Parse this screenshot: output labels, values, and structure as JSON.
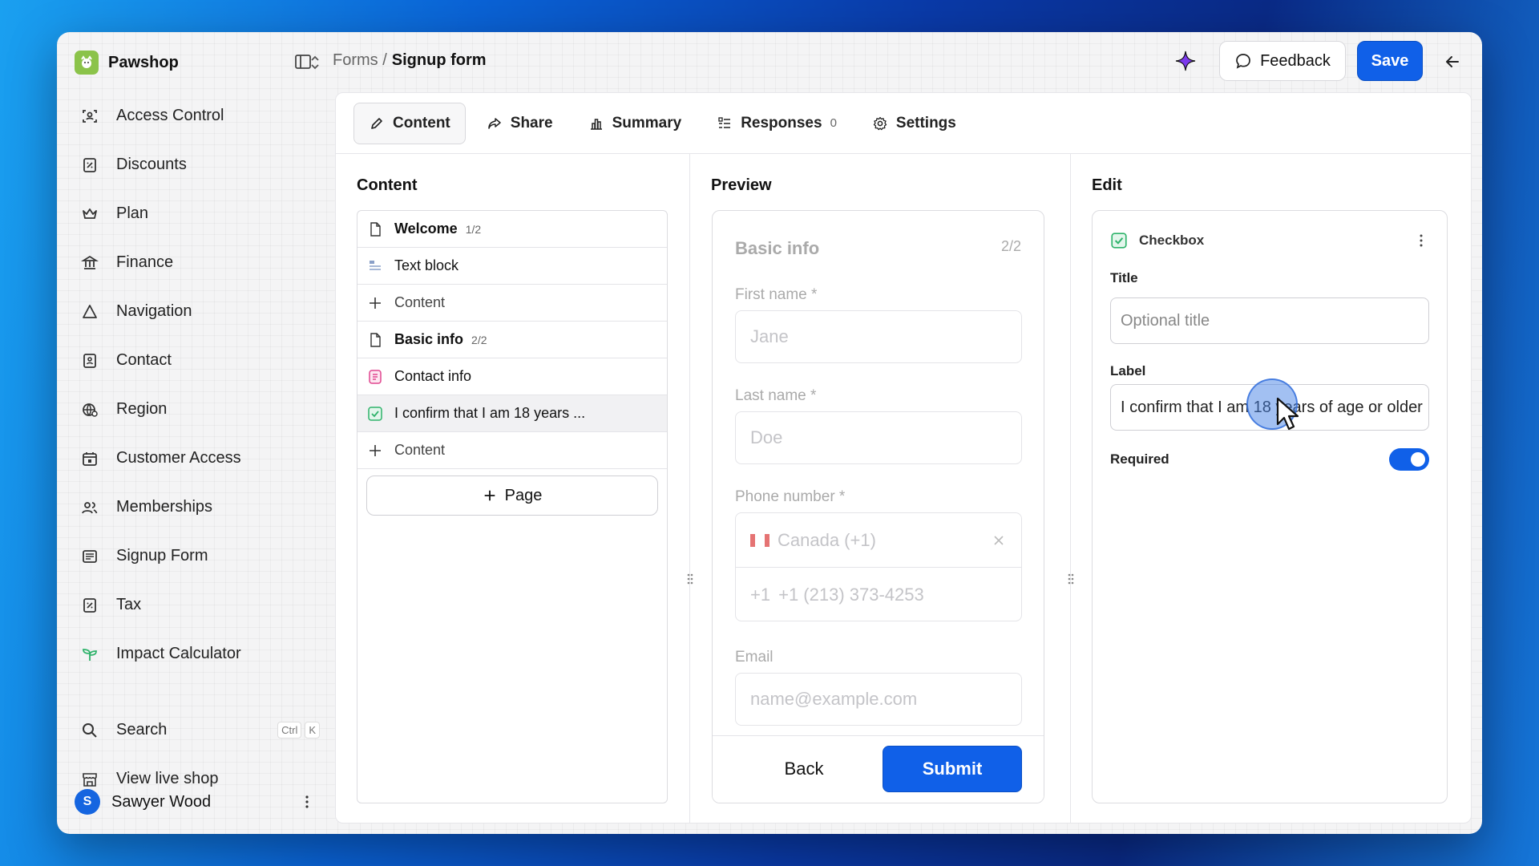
{
  "app": {
    "shop_name": "Pawshop"
  },
  "sidebar": {
    "items": [
      {
        "label": "Access Control",
        "icon": "access-control-icon"
      },
      {
        "label": "Discounts",
        "icon": "discount-icon"
      },
      {
        "label": "Plan",
        "icon": "crown-icon"
      },
      {
        "label": "Finance",
        "icon": "bank-icon"
      },
      {
        "label": "Navigation",
        "icon": "triangle-icon"
      },
      {
        "label": "Contact",
        "icon": "contact-icon"
      },
      {
        "label": "Region",
        "icon": "globe-icon"
      },
      {
        "label": "Customer Access",
        "icon": "calendar-lock-icon"
      },
      {
        "label": "Memberships",
        "icon": "users-icon"
      },
      {
        "label": "Signup Form",
        "icon": "form-icon"
      },
      {
        "label": "Tax",
        "icon": "tax-icon"
      },
      {
        "label": "Impact Calculator",
        "icon": "sprout-icon"
      }
    ],
    "search_label": "Search",
    "search_kbd_1": "Ctrl",
    "search_kbd_2": "K",
    "view_shop_label": "View live shop",
    "user_initial": "S",
    "user_name": "Sawyer Wood"
  },
  "header": {
    "breadcrumb_parent": "Forms /",
    "breadcrumb_current": "Signup form",
    "feedback_label": "Feedback",
    "save_label": "Save"
  },
  "tabs": [
    {
      "label": "Content",
      "icon": "pencil-icon",
      "active": true
    },
    {
      "label": "Share",
      "icon": "share-icon"
    },
    {
      "label": "Summary",
      "icon": "bar-chart-icon"
    },
    {
      "label": "Responses",
      "icon": "list-icon",
      "count": "0"
    },
    {
      "label": "Settings",
      "icon": "gear-icon"
    }
  ],
  "content": {
    "title": "Content",
    "rows": [
      {
        "label": "Welcome",
        "num": "1/2",
        "icon": "page-icon",
        "bold": true
      },
      {
        "label": "Text block",
        "icon": "text-block-icon"
      },
      {
        "label": "Content",
        "icon": "plus-icon"
      },
      {
        "label": "Basic info",
        "num": "2/2",
        "icon": "page-icon",
        "bold": true
      },
      {
        "label": "Contact info",
        "icon": "contact-info-icon"
      },
      {
        "label": "I confirm that I am 18 years ...",
        "icon": "checkbox-icon",
        "selected": true
      },
      {
        "label": "Content",
        "icon": "plus-icon"
      }
    ],
    "page_button": "Page"
  },
  "preview": {
    "title": "Preview",
    "section_title": "Basic info",
    "section_count": "2/2",
    "first_name_label": "First name *",
    "first_name_placeholder": "Jane",
    "last_name_label": "Last name *",
    "last_name_placeholder": "Doe",
    "phone_label": "Phone number *",
    "phone_country": "Canada (+1)",
    "phone_prefix": "+1",
    "phone_placeholder": "+1 (213) 373-4253",
    "email_label": "Email",
    "email_placeholder": "name@example.com",
    "back_label": "Back",
    "submit_label": "Submit"
  },
  "edit": {
    "title": "Edit",
    "block_type": "Checkbox",
    "title_label": "Title",
    "title_placeholder": "Optional title",
    "label_label": "Label",
    "label_value": "I confirm that I am 18 years of age or older",
    "required_label": "Required",
    "required_on": true
  },
  "colors": {
    "accent": "#1060e8",
    "checkbox_green": "#2fb36b",
    "contact_pink": "#e0468f"
  }
}
